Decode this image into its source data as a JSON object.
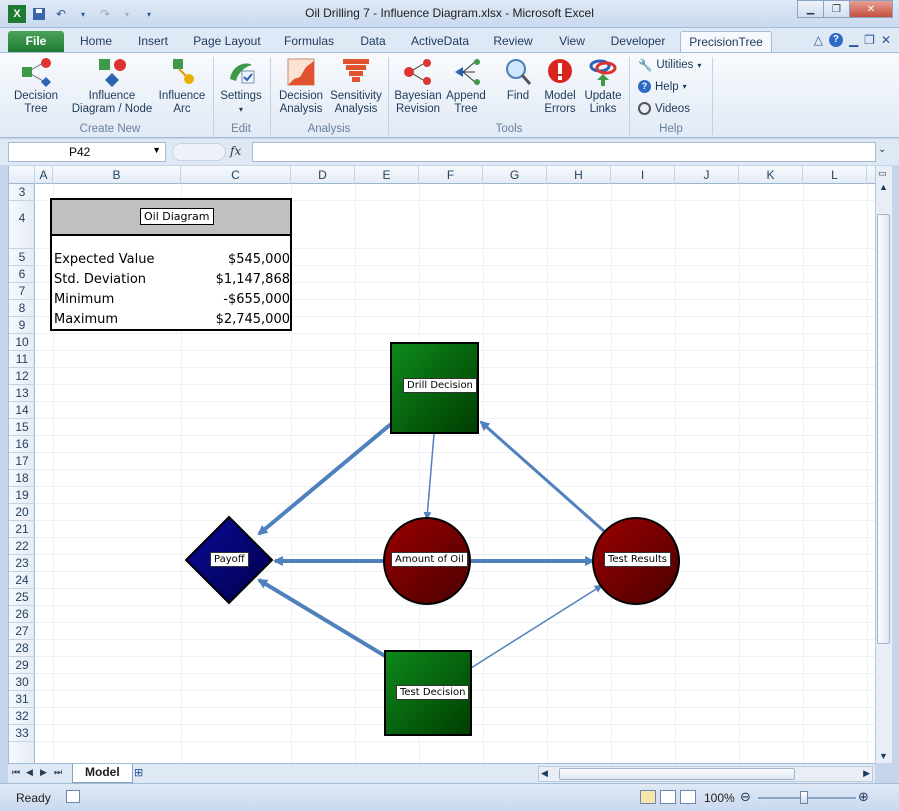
{
  "window": {
    "title": "Oil Drilling 7 - Influence Diagram.xlsx  -  Microsoft Excel"
  },
  "ribbon_tabs": [
    "File",
    "Home",
    "Insert",
    "Page Layout",
    "Formulas",
    "Data",
    "ActiveData",
    "Review",
    "View",
    "Developer",
    "PrecisionTree"
  ],
  "ribbon": {
    "create_new": {
      "group": "Create New",
      "decision_tree": "Decision\nTree",
      "influence_node": "Influence\nDiagram / Node",
      "influence_arc": "Influence\nArc"
    },
    "edit": {
      "group": "Edit",
      "settings": "Settings"
    },
    "analysis": {
      "group": "Analysis",
      "decision_analysis": "Decision\nAnalysis",
      "sensitivity_analysis": "Sensitivity\nAnalysis"
    },
    "tools": {
      "group": "Tools",
      "bayesian_revision": "Bayesian\nRevision",
      "append_tree": "Append\nTree",
      "find": "Find",
      "model_errors": "Model\nErrors",
      "update_links": "Update\nLinks"
    },
    "help": {
      "group": "Help",
      "utilities": "Utilities",
      "help": "Help",
      "videos": "Videos"
    }
  },
  "formula_bar": {
    "name_box": "P42",
    "fx": "fx",
    "formula": ""
  },
  "columns": [
    "A",
    "B",
    "C",
    "D",
    "E",
    "F",
    "G",
    "H",
    "I",
    "J",
    "K",
    "L"
  ],
  "rows": [
    "3",
    "4",
    "5",
    "6",
    "7",
    "8",
    "9",
    "10",
    "11",
    "12",
    "13",
    "14",
    "15",
    "16",
    "17",
    "18",
    "19",
    "20",
    "21",
    "22",
    "23",
    "24",
    "25",
    "26",
    "27",
    "28",
    "29",
    "30",
    "31",
    "32",
    "33"
  ],
  "summary": {
    "title": "Oil Diagram",
    "rows": [
      {
        "label": "Expected Value",
        "value": "$545,000"
      },
      {
        "label": "Std. Deviation",
        "value": "$1,147,868"
      },
      {
        "label": "Minimum",
        "value": "-$655,000"
      },
      {
        "label": "Maximum",
        "value": "$2,745,000"
      }
    ]
  },
  "diagram": {
    "nodes": {
      "drill_decision": "Drill Decision",
      "payoff": "Payoff",
      "amount_of_oil": "Amount of Oil",
      "test_results": "Test Results",
      "test_decision": "Test Decision"
    },
    "colors": {
      "decision": "#006400",
      "chance": "#7a0000",
      "payoff": "#000080",
      "arc": "#4f81bd"
    }
  },
  "sheet_tabs": [
    "Model"
  ],
  "status": {
    "ready": "Ready",
    "zoom": "100%"
  }
}
